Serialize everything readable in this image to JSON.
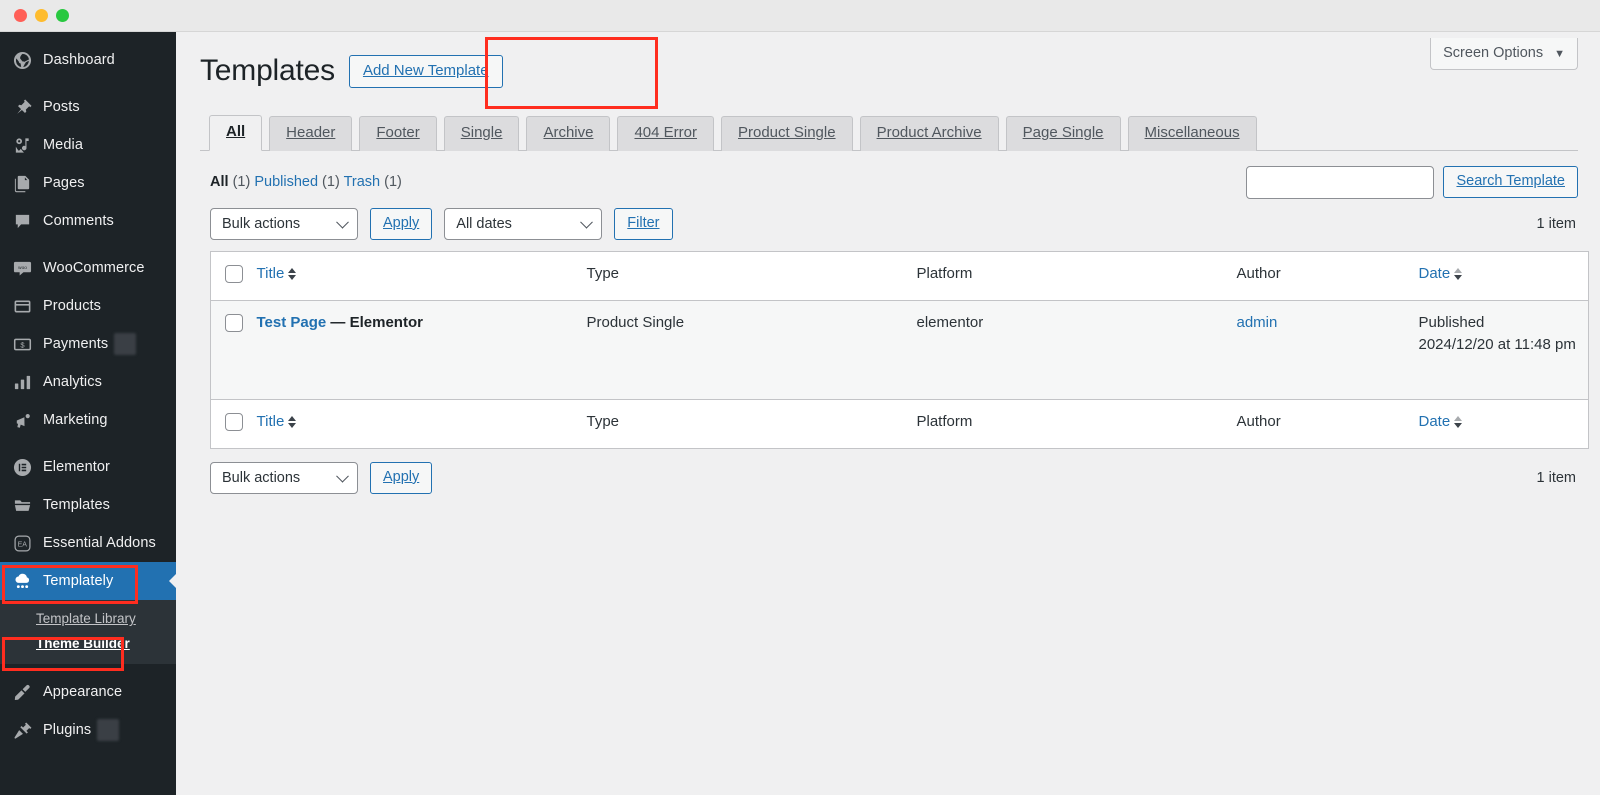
{
  "window": {
    "traffic_lights": [
      "close",
      "minimize",
      "maximize"
    ],
    "colors": {
      "close": "#ff5f57",
      "minimize": "#febc2e",
      "maximize": "#28c840"
    }
  },
  "theme": {
    "sidebar_bg": "#1d2327",
    "submenu_bg": "#2c3338",
    "accent_blue": "#2271b1",
    "highlight_red": "#ff2d1f",
    "content_bg": "#f0f0f1"
  },
  "sidebar": {
    "groups": [
      {
        "items": [
          {
            "label": "Dashboard",
            "icon": "dashboard-icon",
            "current": false
          }
        ]
      },
      {
        "items": [
          {
            "label": "Posts",
            "icon": "pin-icon",
            "current": false
          },
          {
            "label": "Media",
            "icon": "media-icon",
            "current": false
          },
          {
            "label": "Pages",
            "icon": "pages-icon",
            "current": false
          },
          {
            "label": "Comments",
            "icon": "comments-icon",
            "current": false
          }
        ]
      },
      {
        "items": [
          {
            "label": "WooCommerce",
            "icon": "woocommerce-icon",
            "current": false
          },
          {
            "label": "Products",
            "icon": "products-icon",
            "current": false
          },
          {
            "label": "Payments",
            "icon": "payments-icon",
            "current": false,
            "badge_redacted": true
          },
          {
            "label": "Analytics",
            "icon": "analytics-icon",
            "current": false
          },
          {
            "label": "Marketing",
            "icon": "marketing-icon",
            "current": false
          }
        ]
      },
      {
        "items": [
          {
            "label": "Elementor",
            "icon": "elementor-icon",
            "current": false
          },
          {
            "label": "Templates",
            "icon": "folder-icon",
            "current": false
          },
          {
            "label": "Essential Addons",
            "icon": "essential-addons-icon",
            "current": false
          },
          {
            "label": "Templately",
            "icon": "templately-icon",
            "current": true
          }
        ]
      },
      {
        "items": [
          {
            "label": "Appearance",
            "icon": "appearance-icon",
            "current": false
          },
          {
            "label": "Plugins",
            "icon": "plugins-icon",
            "current": false,
            "badge_redacted": true
          }
        ]
      }
    ],
    "submenu": {
      "parent": "Templately",
      "items": [
        {
          "label": "Template Library",
          "current": false
        },
        {
          "label": "Theme Builder",
          "current": true
        }
      ]
    }
  },
  "screen_options": {
    "label": "Screen Options",
    "caret": "▼"
  },
  "header": {
    "title": "Templates",
    "add_new_label": "Add New Template"
  },
  "tabs": [
    {
      "label": "All",
      "active": true
    },
    {
      "label": "Header",
      "active": false
    },
    {
      "label": "Footer",
      "active": false
    },
    {
      "label": "Single",
      "active": false
    },
    {
      "label": "Archive",
      "active": false
    },
    {
      "label": "404 Error",
      "active": false
    },
    {
      "label": "Product Single",
      "active": false
    },
    {
      "label": "Product Archive",
      "active": false
    },
    {
      "label": "Page Single",
      "active": false
    },
    {
      "label": "Miscellaneous",
      "active": false
    }
  ],
  "statuses": [
    {
      "label": "All",
      "count": "(1)",
      "current": true
    },
    {
      "label": "Published",
      "count": "(1)",
      "current": false
    },
    {
      "label": "Trash",
      "count": "(1)",
      "current": false
    }
  ],
  "search": {
    "value": "",
    "placeholder": "",
    "button_label": "Search Template"
  },
  "tablenav_top": {
    "bulk_actions_value": "Bulk actions",
    "apply_label": "Apply",
    "dates_value": "All dates",
    "filter_label": "Filter",
    "item_count": "1 item"
  },
  "tablenav_bottom": {
    "bulk_actions_value": "Bulk actions",
    "apply_label": "Apply",
    "item_count": "1 item"
  },
  "table": {
    "columns": {
      "title": "Title",
      "type": "Type",
      "platform": "Platform",
      "author": "Author",
      "date": "Date"
    },
    "rows": [
      {
        "title_link": "Test Page",
        "title_suffix": "— Elementor",
        "type": "Product Single",
        "platform": "elementor",
        "author": "admin",
        "date_status": "Published",
        "date_value": "2024/12/20 at 11:48 pm"
      }
    ]
  }
}
